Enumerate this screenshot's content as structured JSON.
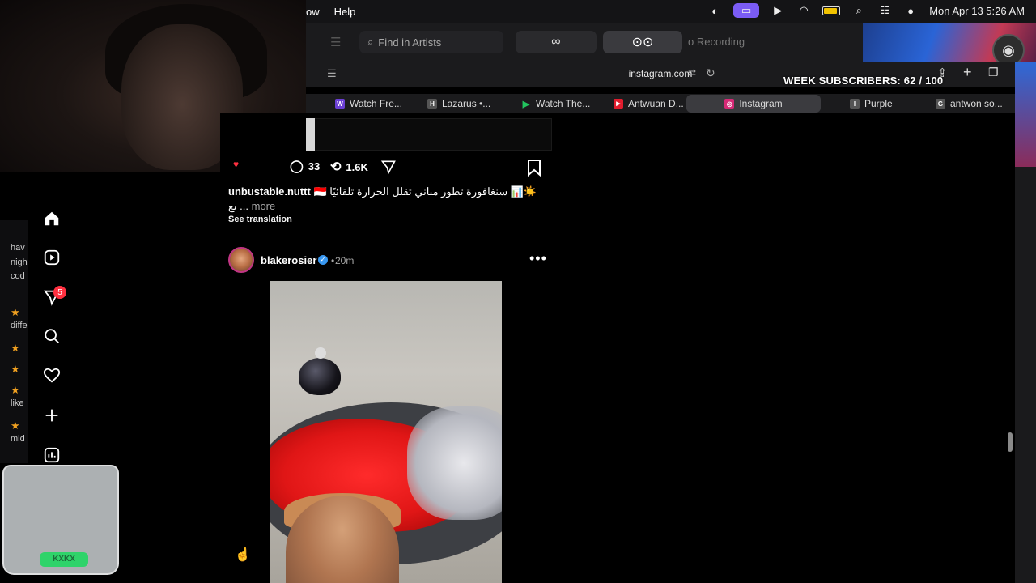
{
  "menubar": {
    "menu_items": [
      "ow",
      "Help"
    ],
    "clock": "Mon Apr 13  5:26 AM"
  },
  "browser": {
    "find_placeholder": "Find in Artists",
    "recording_label": "o Recording",
    "url": "instagram.com",
    "overlay_subscribers": "WEEK SUBSCRIBERS: 62 / 100",
    "tabs": [
      {
        "label": "Watch Fre...",
        "favicon_color": "#6b3fd4",
        "favicon_text": "W"
      },
      {
        "label": "Lazarus •...",
        "favicon_color": "#555555",
        "favicon_text": "H"
      },
      {
        "label": "Watch The...",
        "favicon_color": "#22c55e",
        "favicon_text": "▶"
      },
      {
        "label": "Antwuan D...",
        "favicon_color": "#e11d2e",
        "favicon_text": "▶"
      },
      {
        "label": "Instagram",
        "favicon_color": "#d62976",
        "favicon_text": "◎",
        "active": true
      },
      {
        "label": "Purple",
        "favicon_color": "#555555",
        "favicon_text": "I"
      },
      {
        "label": "antwon so...",
        "favicon_color": "#555555",
        "favicon_text": "G"
      }
    ]
  },
  "ig_nav": {
    "notifications_count": "5"
  },
  "left_sliver": {
    "lines": [
      "hav",
      "nigh",
      "cod",
      "diffe",
      "like",
      "mid"
    ]
  },
  "cup": {
    "logo_text": "KXKX"
  },
  "prev_post": {
    "comments": "33",
    "reposts": "1.6K",
    "caption_user": "unbustable.nuttt",
    "caption_text": "🇮🇩 سنغافورة تطور مباني تقلل الحرارة تلقائيًا 📊☀️",
    "caption_line2": "بع ...",
    "more_label": "more",
    "see_translation": "See translation"
  },
  "post": {
    "username": "blakerosier",
    "time": "20m",
    "dot": "•"
  },
  "colors": {
    "accent_badge": "#ff3040",
    "verified": "#3897f0",
    "story_ring": "#c13584"
  }
}
